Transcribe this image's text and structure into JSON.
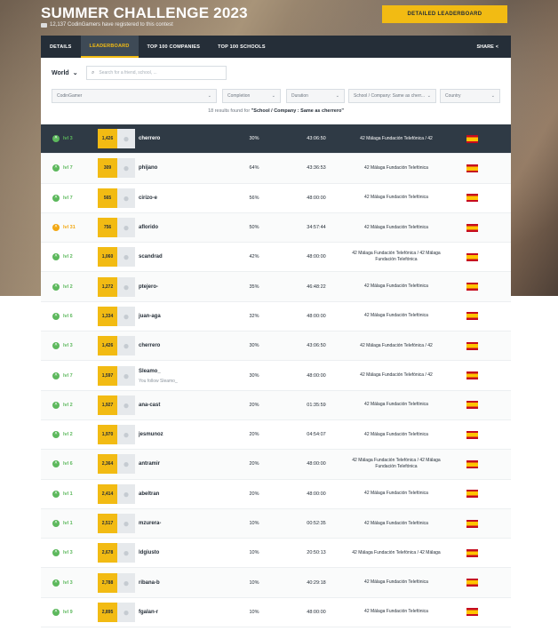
{
  "header": {
    "title": "SUMMER CHALLENGE 2023",
    "subtitle": "12,137 CodinGamers have registered to this contest",
    "leaderboard_button": "DETAILED LEADERBOARD"
  },
  "tabs": [
    {
      "label": "DETAILS"
    },
    {
      "label": "LEADERBOARD"
    },
    {
      "label": "TOP 100 COMPANIES"
    },
    {
      "label": "TOP 100 SCHOOLS"
    }
  ],
  "share_label": "SHARE",
  "filters": {
    "scope": "World",
    "search_placeholder": "Search for a friend, school, ...",
    "codingamer": "CodinGamer",
    "completion": "Completion",
    "duration": "Duration",
    "school": "School / Company: Same as cherr...",
    "country": "Country"
  },
  "results": {
    "count_text": "18 results found for",
    "filter_text": "\"School / Company : Same as cherrero\""
  },
  "rows": [
    {
      "level": "lvl 3",
      "rank": "1,426",
      "name": "cherrero",
      "completion": "30%",
      "duration": "43:06:50",
      "school": "42 Málaga Fundación Telefónica / 42",
      "me": true,
      "gold": false,
      "follow": ""
    },
    {
      "level": "lvl 7",
      "rank": "309",
      "name": "phijano",
      "completion": "64%",
      "duration": "43:36:53",
      "school": "42 Málaga Fundación Telefónica",
      "me": false,
      "gold": false,
      "follow": ""
    },
    {
      "level": "lvl 7",
      "rank": "565",
      "name": "cirizo-e",
      "completion": "56%",
      "duration": "48:00:00",
      "school": "42 Málaga Fundación Telefónica",
      "me": false,
      "gold": false,
      "follow": ""
    },
    {
      "level": "lvl 31",
      "rank": "756",
      "name": "aflorido",
      "completion": "50%",
      "duration": "34:57:44",
      "school": "42 Málaga Fundación Telefónica",
      "me": false,
      "gold": true,
      "follow": ""
    },
    {
      "level": "lvl 2",
      "rank": "1,060",
      "name": "scandrad",
      "completion": "42%",
      "duration": "48:00:00",
      "school": "42 Málaga Fundación Telefónica / 42 Málaga Fundación Telefónica",
      "me": false,
      "gold": false,
      "follow": ""
    },
    {
      "level": "lvl 2",
      "rank": "1,272",
      "name": "ptejero-",
      "completion": "35%",
      "duration": "46:48:22",
      "school": "42 Málaga Fundación Telefónica",
      "me": false,
      "gold": false,
      "follow": ""
    },
    {
      "level": "lvl 6",
      "rank": "1,334",
      "name": "juan-aga",
      "completion": "32%",
      "duration": "48:00:00",
      "school": "42 Málaga Fundación Telefónica",
      "me": false,
      "gold": false,
      "follow": ""
    },
    {
      "level": "lvl 3",
      "rank": "1,426",
      "name": "cherrero",
      "completion": "30%",
      "duration": "43:06:50",
      "school": "42 Málaga Fundación Telefónica / 42",
      "me": false,
      "gold": false,
      "follow": ""
    },
    {
      "level": "lvl 7",
      "rank": "1,597",
      "name": "Sleamo_",
      "completion": "30%",
      "duration": "48:00:00",
      "school": "42 Málaga Fundación Telefónica / 42",
      "me": false,
      "gold": false,
      "follow": "You follow Sleamo_"
    },
    {
      "level": "lvl 2",
      "rank": "1,927",
      "name": "ana-cast",
      "completion": "20%",
      "duration": "01:35:59",
      "school": "42 Málaga Fundación Telefónica",
      "me": false,
      "gold": false,
      "follow": ""
    },
    {
      "level": "lvl 2",
      "rank": "1,970",
      "name": "jesmunoz",
      "completion": "20%",
      "duration": "04:54:07",
      "school": "42 Málaga Fundación Telefónica",
      "me": false,
      "gold": false,
      "follow": ""
    },
    {
      "level": "lvl 6",
      "rank": "2,364",
      "name": "antramir",
      "completion": "20%",
      "duration": "48:00:00",
      "school": "42 Málaga Fundación Telefónica / 42 Málaga Fundación Telefónica",
      "me": false,
      "gold": false,
      "follow": ""
    },
    {
      "level": "lvl 1",
      "rank": "2,414",
      "name": "abeltran",
      "completion": "20%",
      "duration": "48:00:00",
      "school": "42 Málaga Fundación Telefónica",
      "me": false,
      "gold": false,
      "follow": ""
    },
    {
      "level": "lvl 1",
      "rank": "2,517",
      "name": "mzurera-",
      "completion": "10%",
      "duration": "00:52:35",
      "school": "42 Málaga Fundación Telefónica",
      "me": false,
      "gold": false,
      "follow": ""
    },
    {
      "level": "lvl 3",
      "rank": "2,678",
      "name": "ldgiusto",
      "completion": "10%",
      "duration": "20:50:13",
      "school": "42 Málaga Fundación Telefónica / 42 Málaga",
      "me": false,
      "gold": false,
      "follow": ""
    },
    {
      "level": "lvl 3",
      "rank": "2,788",
      "name": "ribana-b",
      "completion": "10%",
      "duration": "40:29:18",
      "school": "42 Málaga Fundación Telefónica",
      "me": false,
      "gold": false,
      "follow": ""
    },
    {
      "level": "lvl 9",
      "rank": "2,895",
      "name": "fgalan-r",
      "completion": "10%",
      "duration": "48:00:00",
      "school": "42 Málaga Fundación Telefónica",
      "me": false,
      "gold": false,
      "follow": ""
    }
  ]
}
